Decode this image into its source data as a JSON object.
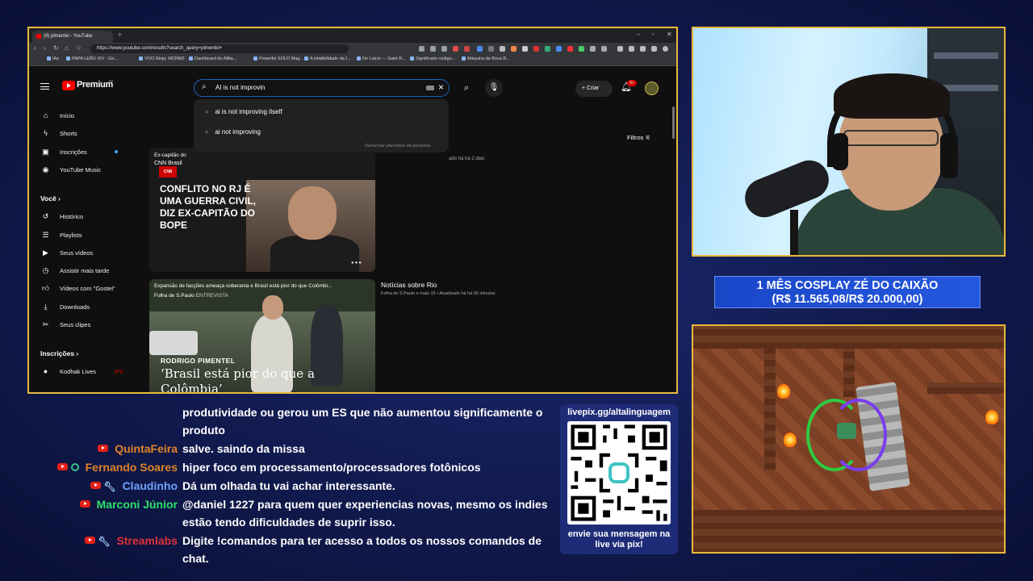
{
  "browser": {
    "tab_title": "(9) pimentel - YouTube",
    "url": "https://www.youtube.com/results?search_query=pimentel+",
    "bookmarks": [
      "IAs",
      "PAPA LEÃO XIV - Go...",
      "VOO.Ninja: MCRM3",
      "Dashboard do Afilia...",
      "Powerful SOLO Mag...",
      "A infalibilidade da I...",
      "De Laicis — Saint R...",
      "Significado código...",
      "Máquina da Bosa B..."
    ]
  },
  "youtube": {
    "brand": "Premium",
    "brand_region": "BR",
    "search_value": "AI is not improvin",
    "suggestions": [
      "ai is not improving itself",
      "ai not improving"
    ],
    "report_link": "Denunciar previsões de pesquisa",
    "create_label": "Criar",
    "notif_count": "9+",
    "filters_label": "Filtros",
    "sidebar": {
      "main": [
        "Início",
        "Shorts",
        "Inscrições",
        "YouTube Music"
      ],
      "you_header": "Você",
      "you": [
        "Histórico",
        "Playlists",
        "Seus vídeos",
        "Assistir mais tarde",
        "Vídeos com \"Gostei\"",
        "Downloads",
        "Seus clipes"
      ],
      "subs_header": "Inscrições",
      "subs": [
        "Kodhak Lives"
      ]
    },
    "card1": {
      "source": "Ex-capitão do",
      "channel": "CNN Brasil",
      "logo": "CNN",
      "headline": "CONFLITO NO RJ É UMA GUERRA CIVIL, DIZ EX-CAPITÃO DO BOPE",
      "meta": "ado há há 2 dias"
    },
    "card2": {
      "title": "Expansão de facções ameaça soberania e Brasil está pior do que Colômbi...",
      "source": "Folha de S.Paulo",
      "tag": "ENTREVISTA",
      "name": "RODRIGO PIMENTEL",
      "quote": "‘Brasil está pior do que a Colômbia’",
      "section_title": "Notícias sobre Rio",
      "section_meta": "Folha de S.Paulo e mais 15 • Atualizado há há 56 minutos"
    }
  },
  "goal": {
    "line1": "1 MÊS COSPLAY ZÉ DO CAIXÃO",
    "line2": "(R$ 11.565,08/R$ 20.000,00)",
    "current": 11565.08,
    "target": 20000.0
  },
  "chat": [
    {
      "user": "",
      "color": "#ffffff",
      "text": "produtividade ou gerou um ES que não aumentou significamente o"
    },
    {
      "user": "",
      "color": "#ffffff",
      "text": "produto"
    },
    {
      "user": "QuintaFeira",
      "color": "#e0832a",
      "text": "salve. saindo da missa"
    },
    {
      "user": "Fernando Soares",
      "color": "#e0832a",
      "text": "hiper foco em processamento/processadores fotônicos"
    },
    {
      "user": "Claudinho",
      "color": "#6fa3ff",
      "text": "Dá um olhada tu vai achar interessante."
    },
    {
      "user": "Marconi Júnior",
      "color": "#2ee06b",
      "text": "@daniel 1227 para quem quer experiencias novas, mesmo os indies"
    },
    {
      "user": "",
      "color": "#ffffff",
      "text": "estão tendo dificuldades de suprir isso."
    },
    {
      "user": "Streamlabs",
      "color": "#e0323a",
      "text": "Digite !comandos para ter acesso a todos os nossos comandos de"
    },
    {
      "user": "",
      "color": "#ffffff",
      "text": "chat."
    }
  ],
  "qr": {
    "url": "livepix.gg/altalinguagem",
    "caption_1": "envie sua mensagem na",
    "caption_2": "live via pix!"
  },
  "colors": {
    "frame": "#e8b93c",
    "youtube_red": "#ff0000",
    "goal_blue": "#2558df",
    "background": "#121c52"
  }
}
